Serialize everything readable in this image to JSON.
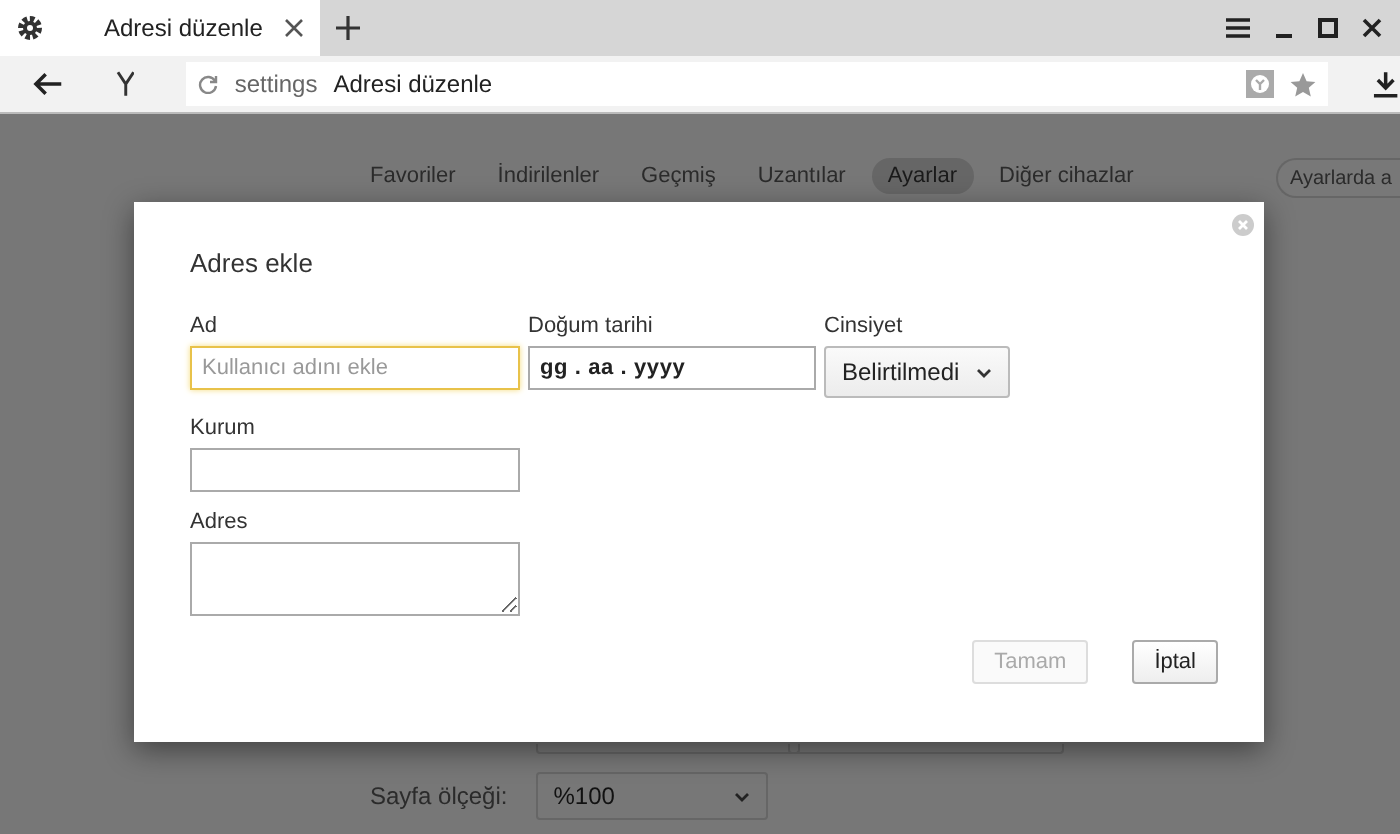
{
  "tab": {
    "title": "Adresi düzenle"
  },
  "address_bar": {
    "scheme": "settings",
    "page": "Adresi düzenle"
  },
  "nav": [
    {
      "label": "Favoriler",
      "selected": false
    },
    {
      "label": "İndirilenler",
      "selected": false
    },
    {
      "label": "Geçmiş",
      "selected": false
    },
    {
      "label": "Uzantılar",
      "selected": false
    },
    {
      "label": "Ayarlar",
      "selected": true
    },
    {
      "label": "Diğer cihazlar",
      "selected": false
    }
  ],
  "search": {
    "placeholder": "Ayarlarda a"
  },
  "page_zoom": {
    "label": "Sayfa ölçeği:",
    "value": "%100"
  },
  "dialog": {
    "title": "Adres ekle",
    "fields": [
      {
        "kind": "text",
        "label": "Ad",
        "placeholder": "Kullanıcı adını ekle",
        "focused": true
      },
      {
        "kind": "date",
        "label": "Doğum tarihi",
        "value": "gg . aa . yyyy"
      },
      {
        "kind": "select",
        "label": "Cinsiyet",
        "value": "Belirtilmedi"
      },
      {
        "kind": "text",
        "label": "Kurum"
      },
      {
        "kind": "textarea",
        "label": "Adres"
      }
    ],
    "buttons": [
      {
        "label": "Tamam",
        "disabled": true
      },
      {
        "label": "İptal",
        "disabled": false
      }
    ]
  }
}
